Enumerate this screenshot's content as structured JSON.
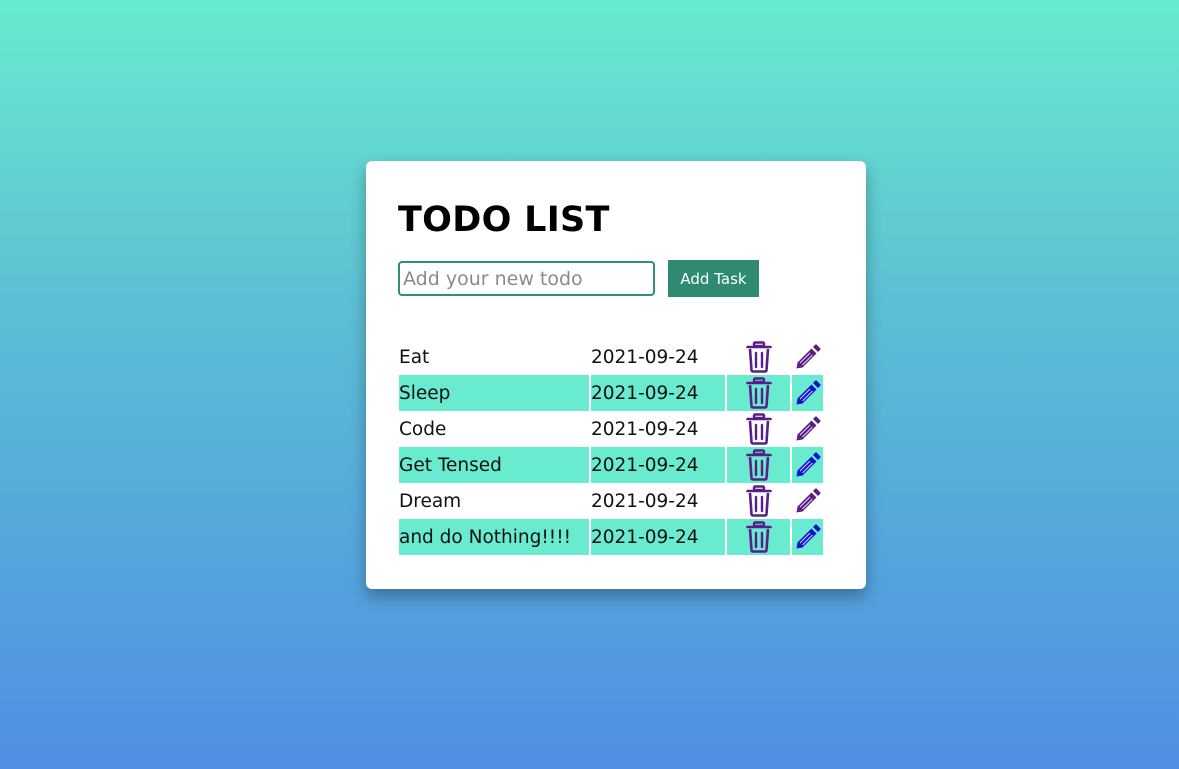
{
  "app": {
    "title": "TODO LIST"
  },
  "form": {
    "input_value": "",
    "input_placeholder": "Add your new todo",
    "add_button_label": "Add Task"
  },
  "colors": {
    "primary": "#2e8b72",
    "row_highlight": "#68ebce",
    "delete_icon": "#5a1f86",
    "edit_icon": "#5a1f86",
    "edit_icon_alt": "#1010d0"
  },
  "icons": {
    "delete": "trash-icon",
    "edit": "pencil-icon"
  },
  "todos": [
    {
      "task": "Eat",
      "date": "2021-09-24"
    },
    {
      "task": "Sleep",
      "date": "2021-09-24"
    },
    {
      "task": "Code",
      "date": "2021-09-24"
    },
    {
      "task": "Get Tensed",
      "date": "2021-09-24"
    },
    {
      "task": "Dream",
      "date": "2021-09-24"
    },
    {
      "task": "and do Nothing!!!!",
      "date": "2021-09-24"
    }
  ]
}
